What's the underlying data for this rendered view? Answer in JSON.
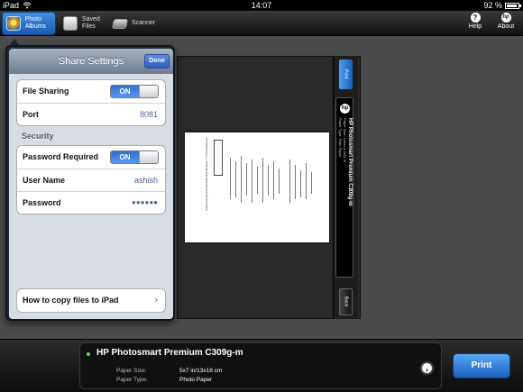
{
  "status_bar": {
    "device": "iPad",
    "time": "14:07",
    "battery": "92 %",
    "battery_level": 0.92
  },
  "toolbar": {
    "tabs": [
      {
        "label": "Photo Albums",
        "icon": "photo-albums-icon",
        "active": true
      },
      {
        "label": "Saved Files",
        "icon": "saved-files-icon",
        "active": false
      },
      {
        "label": "Scanner",
        "icon": "scanner-icon",
        "active": false
      }
    ],
    "help_label": "Help",
    "about_label": "About",
    "about_icon_text": "hp"
  },
  "share_settings": {
    "title": "Share Settings",
    "done_label": "Done",
    "file_sharing_label": "File Sharing",
    "file_sharing_value": "ON",
    "port_label": "Port",
    "port_value": "8081",
    "security_header": "Security",
    "password_required_label": "Password Required",
    "password_required_value": "ON",
    "username_label": "User Name",
    "username_value": "ashish",
    "password_label": "Password",
    "password_value": "●●●●●●",
    "help_link_label": "How to copy files to iPad"
  },
  "preview": {
    "print_label": "Print",
    "back_label": "Back",
    "printer_name": "HP Photosmart Premium C309g-m",
    "paper_size_value": "Letter 8.5x11 in",
    "paper_type_value": "Plain Paper"
  },
  "printer_panel": {
    "name": "HP Photosmart Premium C309g-m",
    "paper_size_label": "Paper Size:",
    "paper_size_value": "5x7 in/13x18 cm",
    "paper_type_label": "Paper Type:",
    "paper_type_value": "Photo Paper",
    "print_button": "Print"
  },
  "colors": {
    "accent_blue": "#2f6fd0",
    "status_green": "#5cd65c",
    "toolbar_dark": "#1a1a1a"
  }
}
